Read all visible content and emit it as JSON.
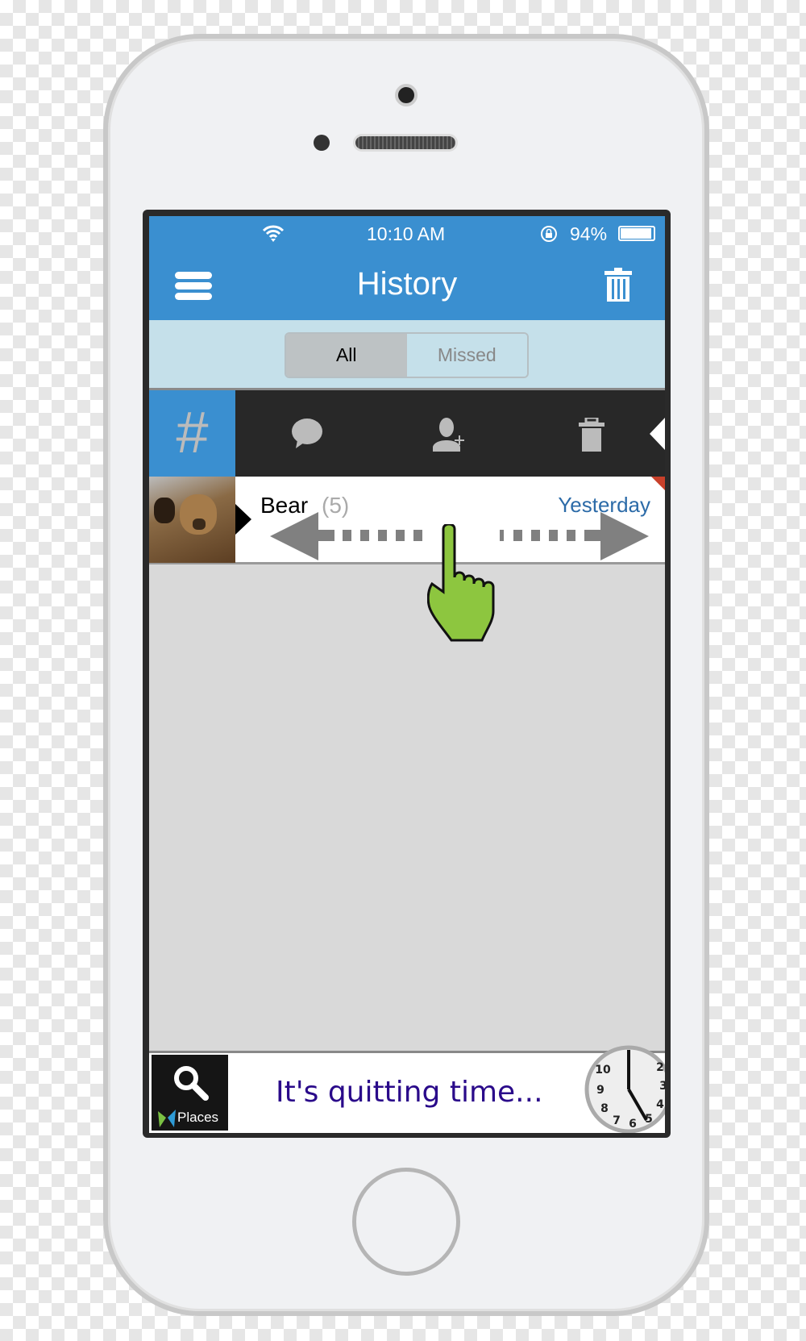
{
  "status_bar": {
    "time": "10:10 AM",
    "battery": "94%",
    "battery_level": 94
  },
  "nav": {
    "title": "History",
    "menu_icon": "hamburger-icon",
    "trash_icon": "trash-icon"
  },
  "segments": [
    {
      "label": "All",
      "selected": true
    },
    {
      "label": "Missed",
      "selected": false
    }
  ],
  "actions": {
    "items": [
      "hash-icon",
      "chat-bubble-icon",
      "add-contact-icon",
      "trash-icon"
    ]
  },
  "history": [
    {
      "name": "Bear",
      "count": "(5)",
      "date": "Yesterday"
    }
  ],
  "ad": {
    "places_label": "Places",
    "text": "It's quitting time..."
  },
  "colors": {
    "accent": "#3a8fd0",
    "date": "#2c6ba8",
    "ad_text": "#2a0a8a",
    "hand": "#8dc63f"
  }
}
